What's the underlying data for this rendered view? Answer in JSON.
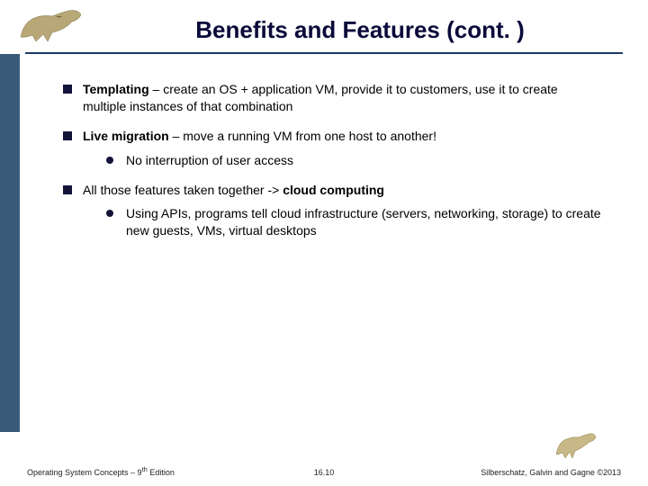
{
  "title": "Benefits and Features (cont. )",
  "bullets": {
    "b1_bold": "Templating",
    "b1_rest": " – create an OS + application VM, provide it to customers, use it to create multiple instances of that combination",
    "b2_bold": "Live migration",
    "b2_rest": " – move a running VM from one host to another!",
    "b2_sub1": "No interruption of user access",
    "b3_pre": "All those features taken together -> ",
    "b3_bold": "cloud computing",
    "b3_sub1": "Using APIs, programs tell cloud infrastructure (servers, networking, storage) to create new guests, VMs, virtual desktops"
  },
  "footer": {
    "left_pre": "Operating System Concepts – 9",
    "left_sup": "th",
    "left_post": " Edition",
    "center": "16.10",
    "right": "Silberschatz, Galvin and Gagne ©2013"
  }
}
